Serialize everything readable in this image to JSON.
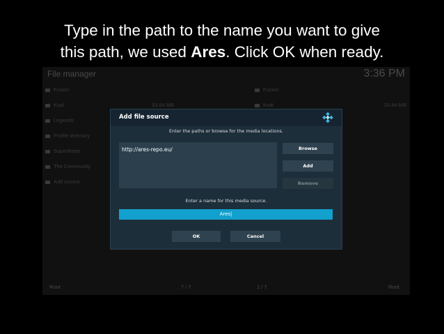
{
  "caption": {
    "line1": "Type in the path to the name you want to give",
    "line2_pre": "this path, we used ",
    "line2_bold": "Ares",
    "line2_post": ". Click OK when ready."
  },
  "file_manager": {
    "title": "File manager",
    "clock": "3:36 PM",
    "left_items": [
      {
        "label": "Fusion",
        "size": ""
      },
      {
        "label": "Kodi",
        "size": "33.84 MB"
      },
      {
        "label": "Legends",
        "size": ""
      },
      {
        "label": "Profile directory",
        "size": ""
      },
      {
        "label": "SuperRepo",
        "size": ""
      },
      {
        "label": "The Community",
        "size": ""
      },
      {
        "label": "Add source",
        "size": ""
      }
    ],
    "right_items": [
      {
        "label": "Fusion",
        "size": ""
      },
      {
        "label": "Kodi",
        "size": "33.84 MB"
      }
    ],
    "footer": {
      "left_root": "Root",
      "left_count": "7 / 7",
      "right_count": "1 / 7",
      "right_root": "Root"
    }
  },
  "dialog": {
    "title": "Add file source",
    "prompt_paths": "Enter the paths or browse for the media locations.",
    "path_value": "http://ares-repo.eu/",
    "browse_label": "Browse",
    "add_label": "Add",
    "remove_label": "Remove",
    "prompt_name": "Enter a name for this media source.",
    "name_value": "Ares|",
    "ok_label": "OK",
    "cancel_label": "Cancel"
  },
  "colors": {
    "dialog_bg": "#1d2e3b",
    "accent": "#12a0ce"
  }
}
